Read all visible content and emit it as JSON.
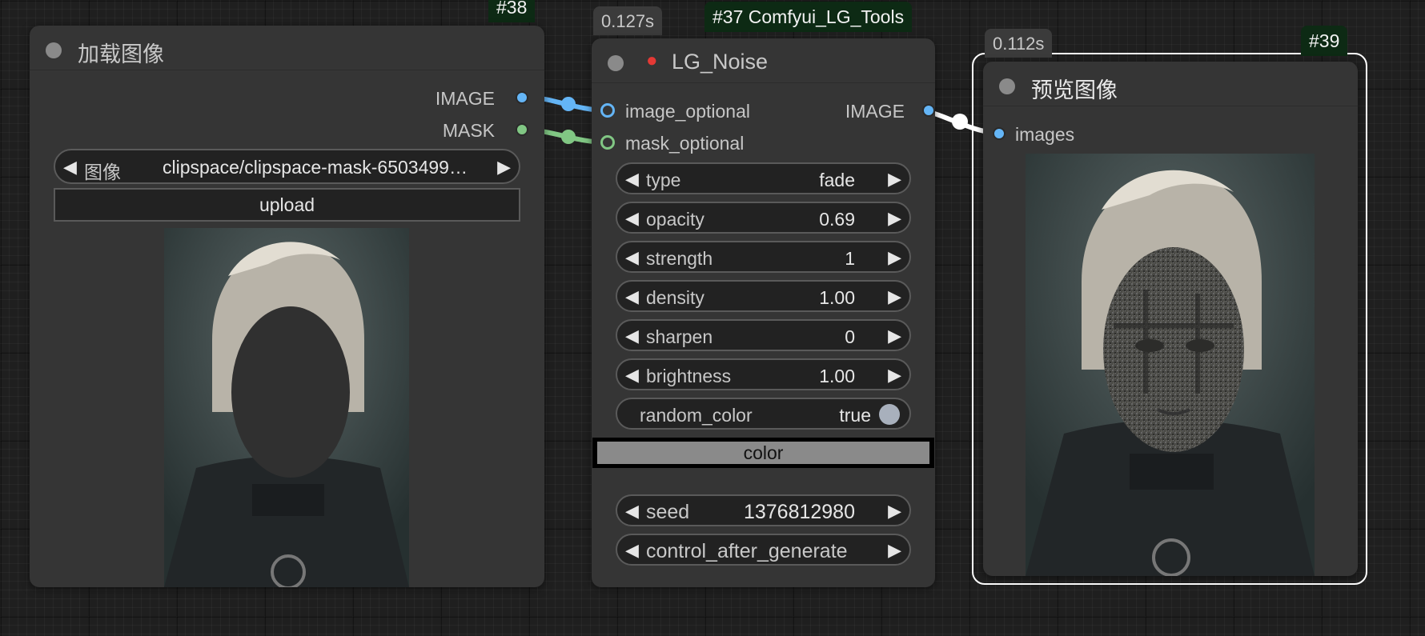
{
  "node38": {
    "badge": "#38",
    "title": "加载图像",
    "outputs": [
      {
        "label": "IMAGE",
        "color": "#64b5f6"
      },
      {
        "label": "MASK",
        "color": "#81c784"
      }
    ],
    "image_widget": {
      "label": "图像",
      "value": "clipspace/clipspace-mask-6503499…"
    },
    "upload_label": "upload"
  },
  "node37": {
    "badge": "#37 Comfyui_LG_Tools",
    "time": "0.127s",
    "title": "LG_Noise",
    "inputs": [
      {
        "label": "image_optional",
        "color": "#64b5f6"
      },
      {
        "label": "mask_optional",
        "color": "#81c784"
      }
    ],
    "output": {
      "label": "IMAGE",
      "color": "#64b5f6"
    },
    "widgets": [
      {
        "label": "type",
        "value": "fade"
      },
      {
        "label": "opacity",
        "value": "0.69"
      },
      {
        "label": "strength",
        "value": "1"
      },
      {
        "label": "density",
        "value": "1.00"
      },
      {
        "label": "sharpen",
        "value": "0"
      },
      {
        "label": "brightness",
        "value": "1.00"
      }
    ],
    "toggle": {
      "label": "random_color",
      "value": "true"
    },
    "color_button": "color",
    "seed": {
      "label": "seed",
      "value": "1376812980"
    },
    "control_after_generate": {
      "label": "control_after_generate"
    }
  },
  "node39": {
    "badge": "#39",
    "time": "0.112s",
    "title": "预览图像",
    "input": {
      "label": "images",
      "color": "#64b5f6"
    }
  },
  "colors": {
    "link_image": "#64b5f6",
    "link_mask": "#81c784",
    "link_out": "#ffffff",
    "selected_outline": "#ffffff"
  }
}
